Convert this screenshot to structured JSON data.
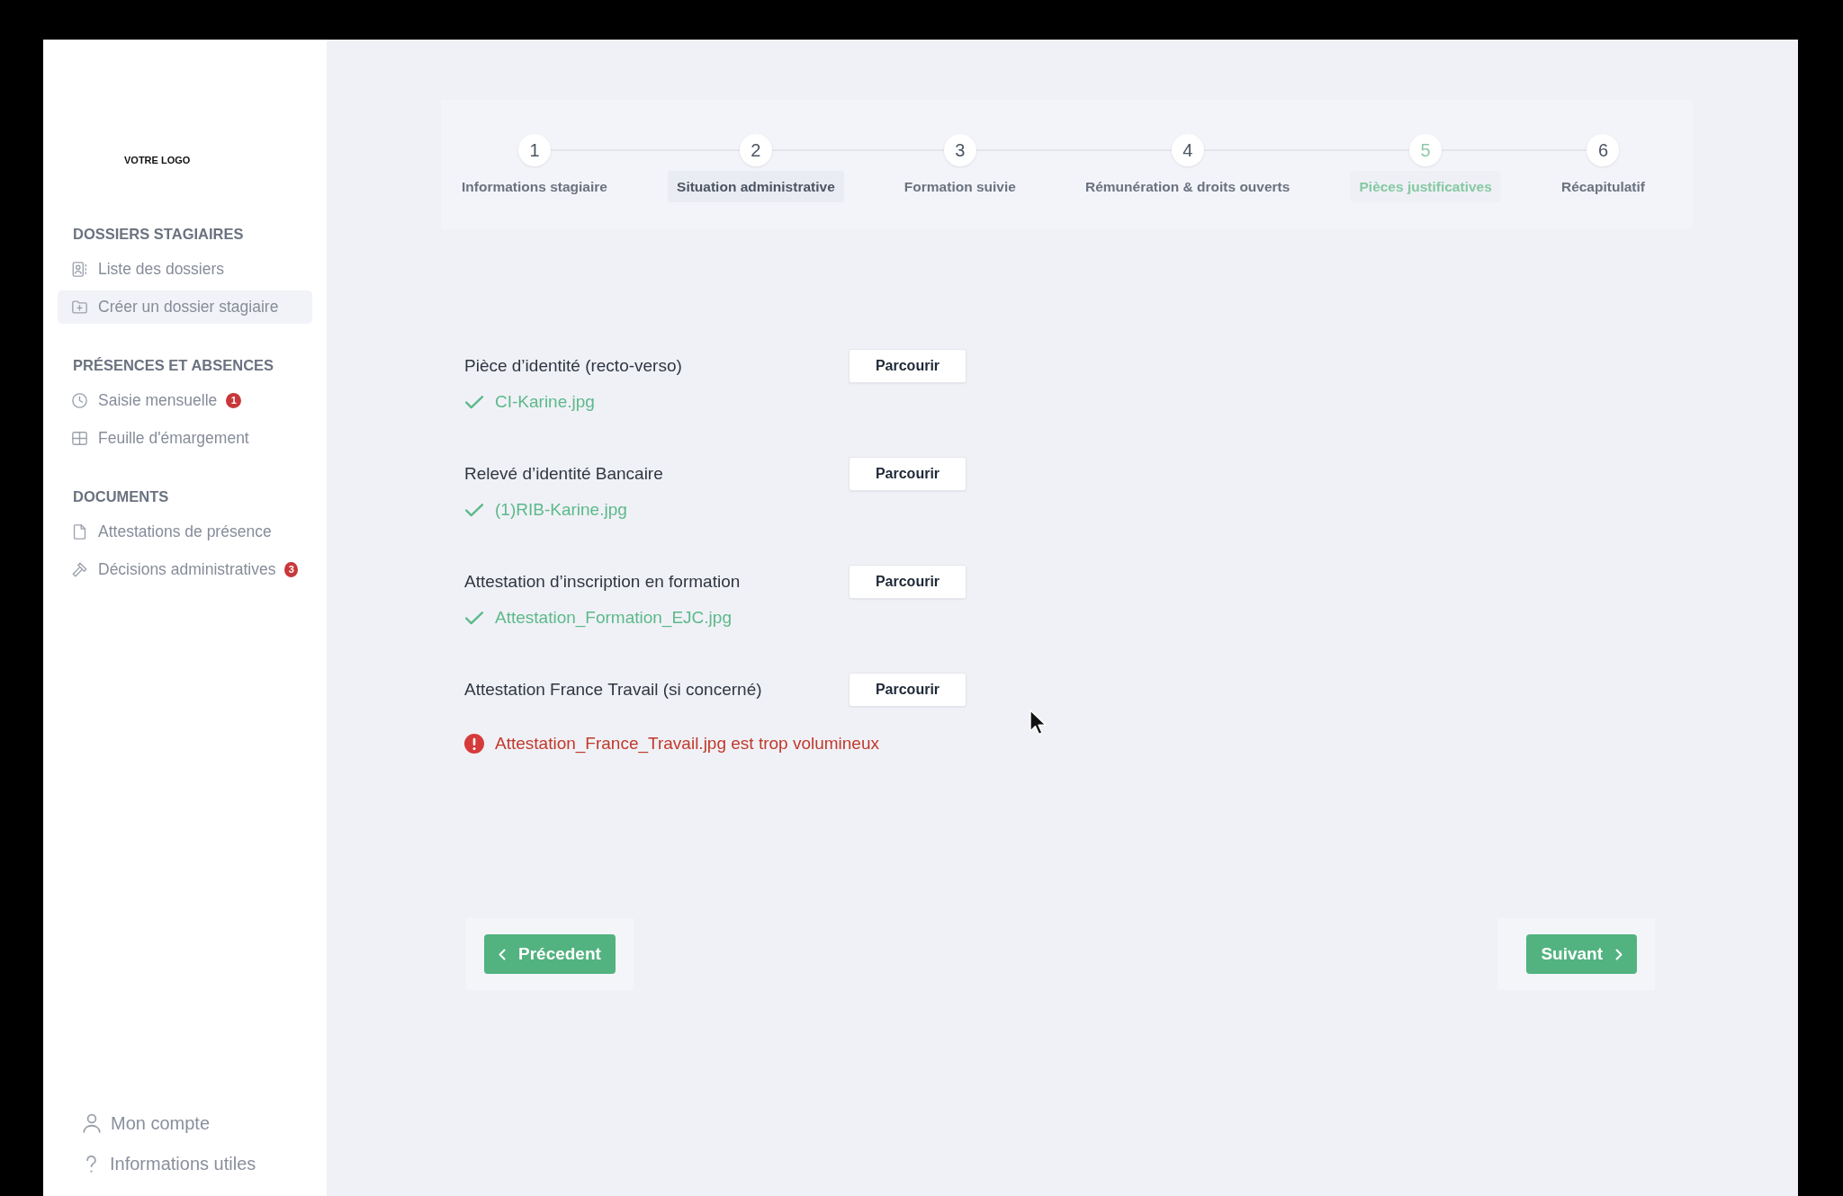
{
  "sidebar": {
    "logo": "VOTRE LOGO",
    "sections": [
      {
        "heading": "DOSSIERS STAGIAIRES",
        "items": [
          {
            "kind": "contacts",
            "label": "Liste des dossiers",
            "selected": false
          },
          {
            "kind": "folder",
            "label": "Créer un dossier stagiaire",
            "selected": true
          }
        ]
      },
      {
        "heading": "PRÉSENCES ET ABSENCES",
        "items": [
          {
            "kind": "clock",
            "label": "Saisie mensuelle",
            "badge": "1",
            "selected": false
          },
          {
            "kind": "grid",
            "label": "Feuille d'émargement",
            "selected": false
          }
        ]
      },
      {
        "heading": "DOCUMENTS",
        "items": [
          {
            "kind": "file",
            "label": "Attestations de présence",
            "selected": false
          },
          {
            "kind": "gavel",
            "label": "Décisions administratives",
            "badge": "3",
            "selected": false
          }
        ]
      }
    ],
    "footer_items": [
      {
        "kind": "user",
        "label": "Mon compte"
      },
      {
        "kind": "help",
        "label": "Informations utiles"
      }
    ]
  },
  "stepper": {
    "steps": [
      {
        "number": "1",
        "label": "Informations stagiaire",
        "selected": false,
        "highlighted": false
      },
      {
        "number": "2",
        "label": "Situation administrative",
        "selected": false,
        "highlighted": true
      },
      {
        "number": "3",
        "label": "Formation suivie",
        "selected": false,
        "highlighted": false
      },
      {
        "number": "4",
        "label": "Rémunération & droits ouverts",
        "selected": false,
        "highlighted": false
      },
      {
        "number": "5",
        "label": "Pièces justificatives",
        "selected": true,
        "highlighted": false
      },
      {
        "number": "6",
        "label": "Récapitulatif",
        "selected": false,
        "highlighted": false
      }
    ]
  },
  "documents": [
    {
      "label": "Pièce d’identité (recto-verso)",
      "button": "Parcourir",
      "status": {
        "kind": "success",
        "text": "CI-Karine.jpg"
      }
    },
    {
      "label": "Relevé d’identité Bancaire",
      "button": "Parcourir",
      "status": {
        "kind": "success",
        "text": "(1)RIB-Karine.jpg"
      }
    },
    {
      "label": "Attestation d’inscription en formation",
      "button": "Parcourir",
      "status": {
        "kind": "success",
        "text": "Attestation_Formation_EJC.jpg"
      }
    },
    {
      "label": "Attestation France Travail (si concerné)",
      "button": "Parcourir",
      "status": {
        "kind": "error",
        "text": "Attestation_France_Travail.jpg est trop volumineux"
      }
    }
  ],
  "navigation": {
    "previous": "Précedent",
    "next": "Suivant"
  }
}
